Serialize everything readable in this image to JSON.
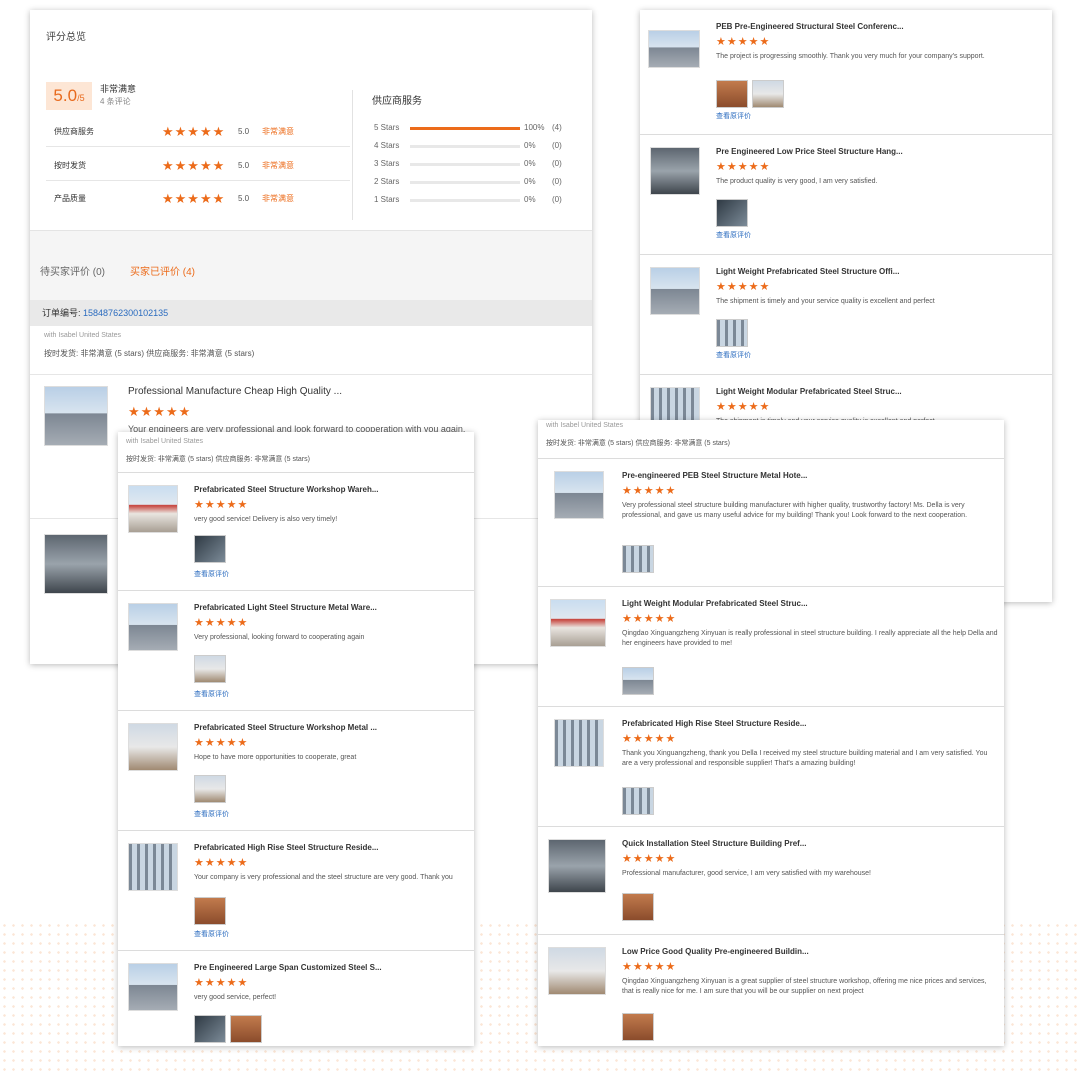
{
  "summary": {
    "title": "评分总览",
    "score": "5.0",
    "score_suffix": "/5",
    "score_label": "非常满意",
    "review_count": "4 条评论",
    "ratings": [
      {
        "label": "供应商服务",
        "stars": "★★★★★",
        "score": "5.0",
        "text": "非常满意"
      },
      {
        "label": "按时发货",
        "stars": "★★★★★",
        "score": "5.0",
        "text": "非常满意"
      },
      {
        "label": "产品质量",
        "stars": "★★★★★",
        "score": "5.0",
        "text": "非常满意"
      }
    ],
    "distribution_title": "供应商服务",
    "distribution": [
      {
        "label": "5 Stars",
        "fill": 1.0,
        "pct": "100%",
        "count": "(4)"
      },
      {
        "label": "4 Stars",
        "fill": 0,
        "pct": "0%",
        "count": "(0)"
      },
      {
        "label": "3 Stars",
        "fill": 0,
        "pct": "0%",
        "count": "(0)"
      },
      {
        "label": "2 Stars",
        "fill": 0,
        "pct": "0%",
        "count": "(0)"
      },
      {
        "label": "1 Stars",
        "fill": 0,
        "pct": "0%",
        "count": "(0)"
      }
    ],
    "tabs": {
      "pending": "待买家评价 (0)",
      "reviewed": "买家已评价 (4)"
    },
    "order_label": "订单编号:",
    "order_number": "15848762300102135",
    "buyer": "with Isabel United States",
    "buyer_rating": "按时发货: 非常满意  (5 stars)      供应商服务: 非常满意  (5 stars)",
    "first_item": {
      "title": "Professional Manufacture Cheap High Quality ...",
      "stars": "★★★★★",
      "comment": "Your engineers are very professional and look forward to cooperation with you again."
    }
  },
  "panel_b": [
    {
      "title": "PEB Pre-Engineered Structural Steel Conferenc...",
      "stars": "★★★★★",
      "comment": "The project is progressing smoothly. Thank you very much for your company's support.",
      "view": "查看原评价"
    },
    {
      "title": "Pre Engineered Low Price Steel Structure Hang...",
      "stars": "★★★★★",
      "comment": "The product quality is very good, I am very satisfied.",
      "view": "查看原评价"
    },
    {
      "title": "Light Weight Prefabricated Steel Structure Offi...",
      "stars": "★★★★★",
      "comment": "The shipment is timely and your service quality is excellent and perfect",
      "view": "查看原评价"
    },
    {
      "title": "Light Weight Modular Prefabricated Steel Struc...",
      "stars": "★★★★★",
      "comment": "The shipment is timely and your service quality is excellent and perfect",
      "view": ""
    }
  ],
  "panel_c": {
    "buyer": "with Isabel United States",
    "rating": "按时发货: 非常满意 (5 stars)     供应商服务: 非常满意 (5 stars)",
    "items": [
      {
        "title": "Prefabricated Steel Structure Workshop Wareh...",
        "stars": "★★★★★",
        "comment": "very good service! Delivery is also very timely!",
        "view": "查看原评价"
      },
      {
        "title": "Prefabricated Light Steel Structure Metal Ware...",
        "stars": "★★★★★",
        "comment": "Very professional, looking forward to cooperating again",
        "view": "查看原评价"
      },
      {
        "title": "Prefabricated Steel Structure Workshop Metal ...",
        "stars": "★★★★★",
        "comment": "Hope to have more opportunities to cooperate, great",
        "view": "查看原评价"
      },
      {
        "title": "Prefabricated High Rise Steel Structure Reside...",
        "stars": "★★★★★",
        "comment": "Your company is very professional and the steel structure are very good. Thank you",
        "view": "查看原评价"
      },
      {
        "title": "Pre Engineered Large Span Customized Steel S...",
        "stars": "★★★★★",
        "comment": "very good service, perfect!",
        "view": ""
      }
    ]
  },
  "panel_d": {
    "buyer": "with Isabel United States",
    "rating": "按时发货: 非常满意  (5 stars)       供应商服务: 非常满意  (5 stars)",
    "items": [
      {
        "title": "Pre-engineered PEB Steel Structure Metal Hote...",
        "stars": "★★★★★",
        "comment": "Very professional steel structure building manufacturer with higher quality, trustworthy factory! Ms. Della is very professional, and gave us many useful advice for my building! Thank you! Look forward to the next cooperation."
      },
      {
        "title": "Light Weight Modular Prefabricated Steel Struc...",
        "stars": "★★★★★",
        "comment": "Qingdao Xinguangzheng Xinyuan is really professional in steel structure building. I really appreciate all the help Della and her engineers have provided to me!"
      },
      {
        "title": "Prefabricated High Rise Steel Structure Reside...",
        "stars": "★★★★★",
        "comment": "Thank you Xinguangzheng, thank you Della I received my steel structure building material and I am very satisfied. You are a very professional and responsible supplier! That's a amazing building!"
      },
      {
        "title": "Quick Installation Steel Structure Building Pref...",
        "stars": "★★★★★",
        "comment": "Professional manufacturer, good service, I am very satisfied with my warehouse!"
      },
      {
        "title": "Low Price Good Quality Pre-engineered Buildin...",
        "stars": "★★★★★",
        "comment": "Qingdao Xinguangzheng Xinyuan is a great supplier of steel structure workshop, offering me nice prices and services, that is really nice for me. I am sure that you will be our supplier on next project"
      }
    ]
  }
}
